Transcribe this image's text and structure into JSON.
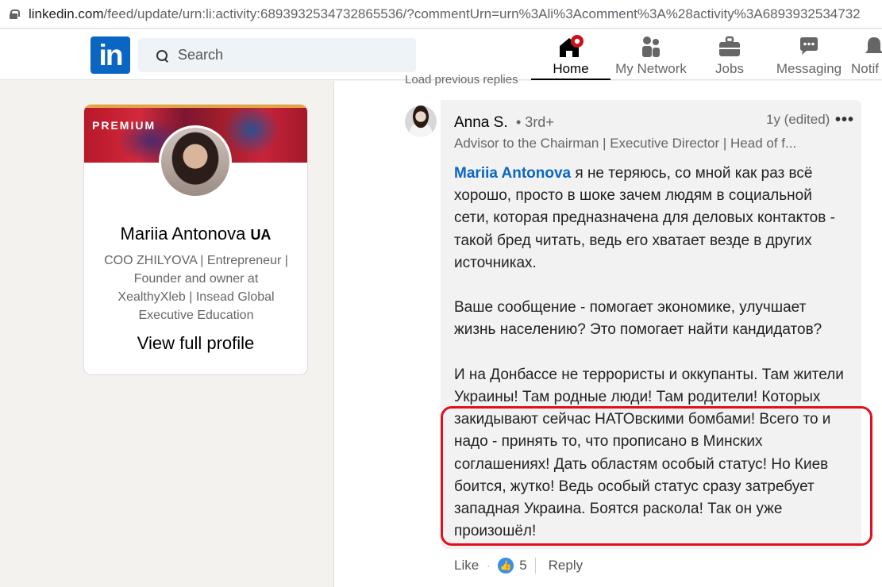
{
  "browser": {
    "url_host": "linkedin.com",
    "url_path": "/feed/update/urn:li:activity:6893932534732865536/?commentUrn=urn%3Ali%3Acomment%3A%28activity%3A6893932534732"
  },
  "nav": {
    "logo": "in",
    "search_placeholder": "Search",
    "items": [
      {
        "label": "Home",
        "icon": "home-icon"
      },
      {
        "label": "My Network",
        "icon": "network-icon"
      },
      {
        "label": "Jobs",
        "icon": "briefcase-icon"
      },
      {
        "label": "Messaging",
        "icon": "chat-icon"
      },
      {
        "label": "Notif",
        "icon": "bell-icon"
      }
    ]
  },
  "profile_card": {
    "badge": "PREMIUM",
    "name": "Mariia Antonova",
    "flag": "UA",
    "headline": "COO ZHILYOVA | Entrepreneur | Founder and owner at XealthyXleb | Insead Global Executive Education",
    "view_profile": "View full profile"
  },
  "comment": {
    "load_previous": "Load previous replies",
    "author": "Anna S.",
    "degree": "• 3rd+",
    "time": "1y (edited)",
    "more": "•••",
    "author_title": "Advisor to the Chairman | Executive Director | Head of f...",
    "mention": "Mariia Antonova",
    "para1": " я не теряюсь, со мной как раз всё хорошо, просто в шоке зачем людям в социальной сети, которая предназначена для деловых контактов - такой бред читать, ведь его хватает везде в других источниках.",
    "para2": "Ваше сообщение - помогает экономике, улучшает жизнь населению? Это помогает найти кандидатов?",
    "para3": "И на Донбассе не террористы и оккупанты. Там жители Украины! Там родные люди! Там родители! Которых закидывают сейчас НАТОвскими бомбами! Всего то и надо - принять то, что прописано в Минских соглашениях! Дать областям особый статус! Но Киев боится, жутко! Ведь особый статус сразу затребует западная Украина. Боятся раскола! Так он уже произошёл!"
  },
  "actions": {
    "like": "Like",
    "dot": "·",
    "reaction_count": "5",
    "reply": "Reply"
  },
  "colors": {
    "brand": "#0a66c2",
    "highlight": "#e0101e"
  }
}
